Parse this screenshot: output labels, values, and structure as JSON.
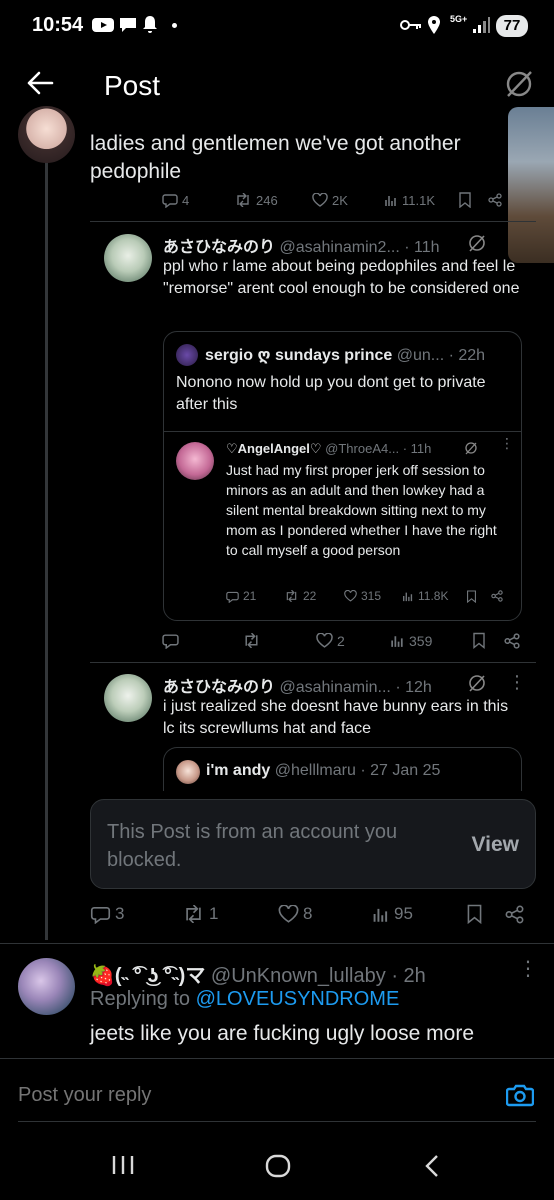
{
  "status": {
    "time": "10:54",
    "network": "5G+",
    "battery": "77"
  },
  "header": {
    "title": "Post"
  },
  "main_post": {
    "text": "ladies and gentlemen we've got another pedophile",
    "replies": "4",
    "reposts": "246",
    "likes": "2K",
    "views": "11.1K"
  },
  "quote1": {
    "name": "あさひなみのり",
    "handle": "@asahinamin2...",
    "time": "· 11h",
    "text": "ppl who r lame about being pedophiles and feel le \"remorse\" arent cool enough to be considered one",
    "nested": {
      "name": "sergio ღ sundays prince",
      "handle": "@un...",
      "time": "· 22h",
      "text": "Nonono now hold up you dont get to private after this",
      "inner": {
        "name": "♡AngelAngel♡",
        "handle": "@ThroeA4...",
        "time": "· 11h",
        "text": "Just had my first proper jerk off session to minors as an adult and then lowkey had a silent mental breakdown sitting next to my mom as I pondered whether I have the right to call myself a good person",
        "replies": "21",
        "reposts": "22",
        "likes": "315",
        "views": "11.8K"
      }
    },
    "likes": "2",
    "views": "359"
  },
  "quote2": {
    "name": "あさひなみのり",
    "handle": "@asahinamin...",
    "time": "· 12h",
    "text": "i just realized she doesnt have bunny ears in this lc its screwllums hat and face",
    "nested": {
      "name": "i'm andy",
      "handle": "@helllmaru",
      "time": "· 27 Jan 25"
    }
  },
  "blocked": {
    "text": "This Post is from an account you blocked.",
    "view": "View"
  },
  "thread_actions": {
    "replies": "3",
    "reposts": "1",
    "likes": "8",
    "views": "95"
  },
  "reply": {
    "name": "🍓(˵ ͡° ͜ʖ ͡°˵)マ",
    "handle": "@UnKnown_lullaby",
    "time": "· 2h",
    "replying_to": "Replying to",
    "mention": "@LOVEUSYNDROME",
    "text": "jeets like you are fucking ugly loose more"
  },
  "composer": {
    "placeholder": "Post your reply"
  },
  "colors": {
    "accent": "#1d9bf0",
    "bg": "#000000",
    "muted": "#71767b",
    "border": "#2f3336"
  }
}
